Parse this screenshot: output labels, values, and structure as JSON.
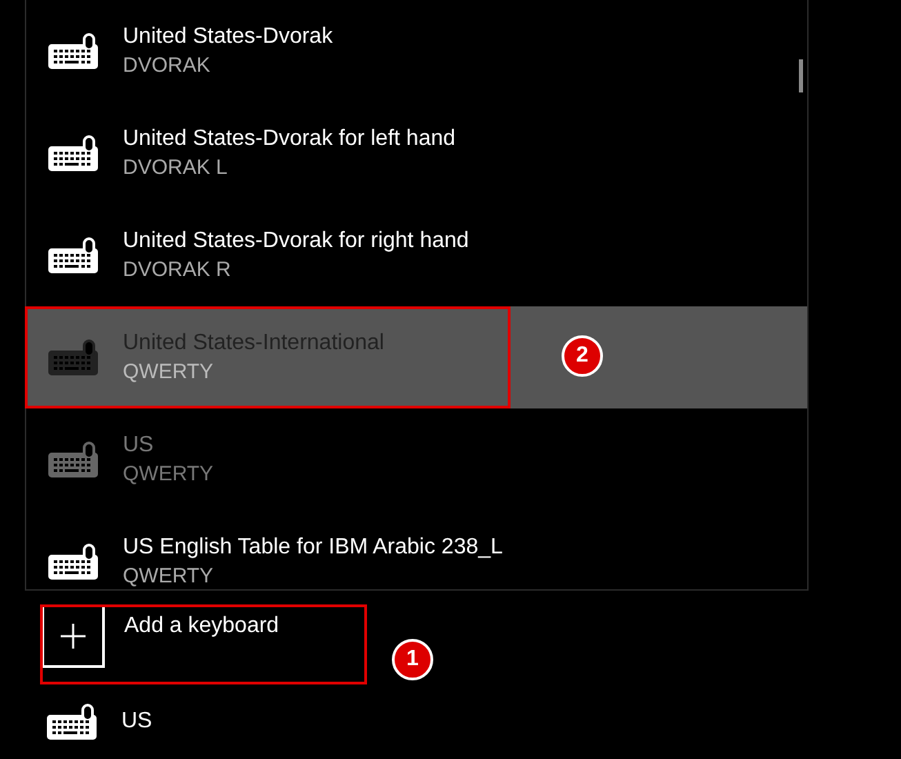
{
  "layouts": [
    {
      "name": "United States-Dvorak",
      "layout": "DVORAK",
      "selected": false,
      "disabled": false
    },
    {
      "name": "United States-Dvorak for left hand",
      "layout": "DVORAK L",
      "selected": false,
      "disabled": false
    },
    {
      "name": "United States-Dvorak for right hand",
      "layout": "DVORAK R",
      "selected": false,
      "disabled": false
    },
    {
      "name": "United States-International",
      "layout": "QWERTY",
      "selected": true,
      "disabled": false,
      "badge": "2"
    },
    {
      "name": "US",
      "layout": "QWERTY",
      "selected": false,
      "disabled": true
    },
    {
      "name": "US English Table for IBM Arabic 238_L",
      "layout": "QWERTY",
      "selected": false,
      "disabled": false
    }
  ],
  "add_button": {
    "label": "Add a keyboard",
    "badge": "1"
  },
  "installed": [
    {
      "name": "US"
    }
  ]
}
